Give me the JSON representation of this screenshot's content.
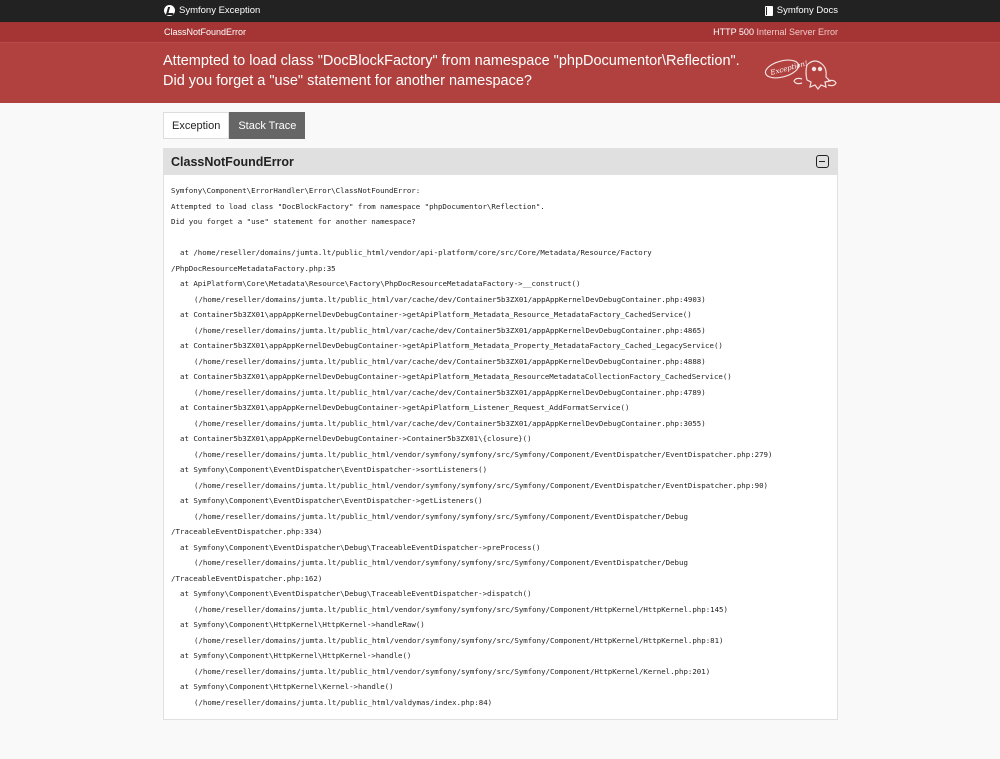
{
  "topbar": {
    "brand": "Symfony Exception",
    "docs": "Symfony Docs"
  },
  "subbar": {
    "exception_class": "ClassNotFoundError",
    "status_code": "HTTP 500",
    "status_text": "Internal Server Error"
  },
  "header": {
    "message_line1": "Attempted to load class \"DocBlockFactory\" from namespace \"phpDocumentor\\Reflection\".",
    "message_line2": "Did you forget a \"use\" statement for another namespace?",
    "ghost_label": "Exception!"
  },
  "tabs": [
    {
      "label": "Exception",
      "active": false
    },
    {
      "label": "Stack Trace",
      "active": true
    }
  ],
  "panel": {
    "title": "ClassNotFoundError",
    "lines": [
      {
        "indent": 1,
        "text": "Symfony\\Component\\ErrorHandler\\Error\\ClassNotFoundError:"
      },
      {
        "indent": 1,
        "text": "Attempted to load class \"DocBlockFactory\" from namespace \"phpDocumentor\\Reflection\"."
      },
      {
        "indent": 1,
        "text": "Did you forget a \"use\" statement for another namespace?"
      },
      {
        "indent": 1,
        "text": ""
      },
      {
        "indent": 2,
        "text": "at /home/reseller/domains/jumta.lt/public_html/vendor/api-platform/core/src/Core/Metadata/Resource/Factory"
      },
      {
        "indent": 1,
        "text": "/PhpDocResourceMetadataFactory.php:35"
      },
      {
        "indent": 2,
        "text": "at ApiPlatform\\Core\\Metadata\\Resource\\Factory\\PhpDocResourceMetadataFactory->__construct()"
      },
      {
        "indent": 3,
        "text": "(/home/reseller/domains/jumta.lt/public_html/var/cache/dev/Container5b3ZX01/appAppKernelDevDebugContainer.php:4903)"
      },
      {
        "indent": 2,
        "text": "at Container5b3ZX01\\appAppKernelDevDebugContainer->getApiPlatform_Metadata_Resource_MetadataFactory_CachedService()"
      },
      {
        "indent": 3,
        "text": "(/home/reseller/domains/jumta.lt/public_html/var/cache/dev/Container5b3ZX01/appAppKernelDevDebugContainer.php:4865)"
      },
      {
        "indent": 2,
        "text": "at Container5b3ZX01\\appAppKernelDevDebugContainer->getApiPlatform_Metadata_Property_MetadataFactory_Cached_LegacyService()"
      },
      {
        "indent": 3,
        "text": "(/home/reseller/domains/jumta.lt/public_html/var/cache/dev/Container5b3ZX01/appAppKernelDevDebugContainer.php:4888)"
      },
      {
        "indent": 2,
        "text": "at Container5b3ZX01\\appAppKernelDevDebugContainer->getApiPlatform_Metadata_ResourceMetadataCollectionFactory_CachedService()"
      },
      {
        "indent": 3,
        "text": "(/home/reseller/domains/jumta.lt/public_html/var/cache/dev/Container5b3ZX01/appAppKernelDevDebugContainer.php:4789)"
      },
      {
        "indent": 2,
        "text": "at Container5b3ZX01\\appAppKernelDevDebugContainer->getApiPlatform_Listener_Request_AddFormatService()"
      },
      {
        "indent": 3,
        "text": "(/home/reseller/domains/jumta.lt/public_html/var/cache/dev/Container5b3ZX01/appAppKernelDevDebugContainer.php:3055)"
      },
      {
        "indent": 2,
        "text": "at Container5b3ZX01\\appAppKernelDevDebugContainer->Container5b3ZX01\\{closure}()"
      },
      {
        "indent": 3,
        "text": "(/home/reseller/domains/jumta.lt/public_html/vendor/symfony/symfony/src/Symfony/Component/EventDispatcher/EventDispatcher.php:279)"
      },
      {
        "indent": 2,
        "text": "at Symfony\\Component\\EventDispatcher\\EventDispatcher->sortListeners()"
      },
      {
        "indent": 3,
        "text": "(/home/reseller/domains/jumta.lt/public_html/vendor/symfony/symfony/src/Symfony/Component/EventDispatcher/EventDispatcher.php:90)"
      },
      {
        "indent": 2,
        "text": "at Symfony\\Component\\EventDispatcher\\EventDispatcher->getListeners()"
      },
      {
        "indent": 3,
        "text": "(/home/reseller/domains/jumta.lt/public_html/vendor/symfony/symfony/src/Symfony/Component/EventDispatcher/Debug"
      },
      {
        "indent": 1,
        "text": "/TraceableEventDispatcher.php:334)"
      },
      {
        "indent": 2,
        "text": "at Symfony\\Component\\EventDispatcher\\Debug\\TraceableEventDispatcher->preProcess()"
      },
      {
        "indent": 3,
        "text": "(/home/reseller/domains/jumta.lt/public_html/vendor/symfony/symfony/src/Symfony/Component/EventDispatcher/Debug"
      },
      {
        "indent": 1,
        "text": "/TraceableEventDispatcher.php:162)"
      },
      {
        "indent": 2,
        "text": "at Symfony\\Component\\EventDispatcher\\Debug\\TraceableEventDispatcher->dispatch()"
      },
      {
        "indent": 3,
        "text": "(/home/reseller/domains/jumta.lt/public_html/vendor/symfony/symfony/src/Symfony/Component/HttpKernel/HttpKernel.php:145)"
      },
      {
        "indent": 2,
        "text": "at Symfony\\Component\\HttpKernel\\HttpKernel->handleRaw()"
      },
      {
        "indent": 3,
        "text": "(/home/reseller/domains/jumta.lt/public_html/vendor/symfony/symfony/src/Symfony/Component/HttpKernel/HttpKernel.php:81)"
      },
      {
        "indent": 2,
        "text": "at Symfony\\Component\\HttpKernel\\HttpKernel->handle()"
      },
      {
        "indent": 3,
        "text": "(/home/reseller/domains/jumta.lt/public_html/vendor/symfony/symfony/src/Symfony/Component/HttpKernel/Kernel.php:201)"
      },
      {
        "indent": 2,
        "text": "at Symfony\\Component\\HttpKernel\\Kernel->handle()"
      },
      {
        "indent": 3,
        "text": "(/home/reseller/domains/jumta.lt/public_html/valdymas/index.php:84)"
      }
    ]
  }
}
